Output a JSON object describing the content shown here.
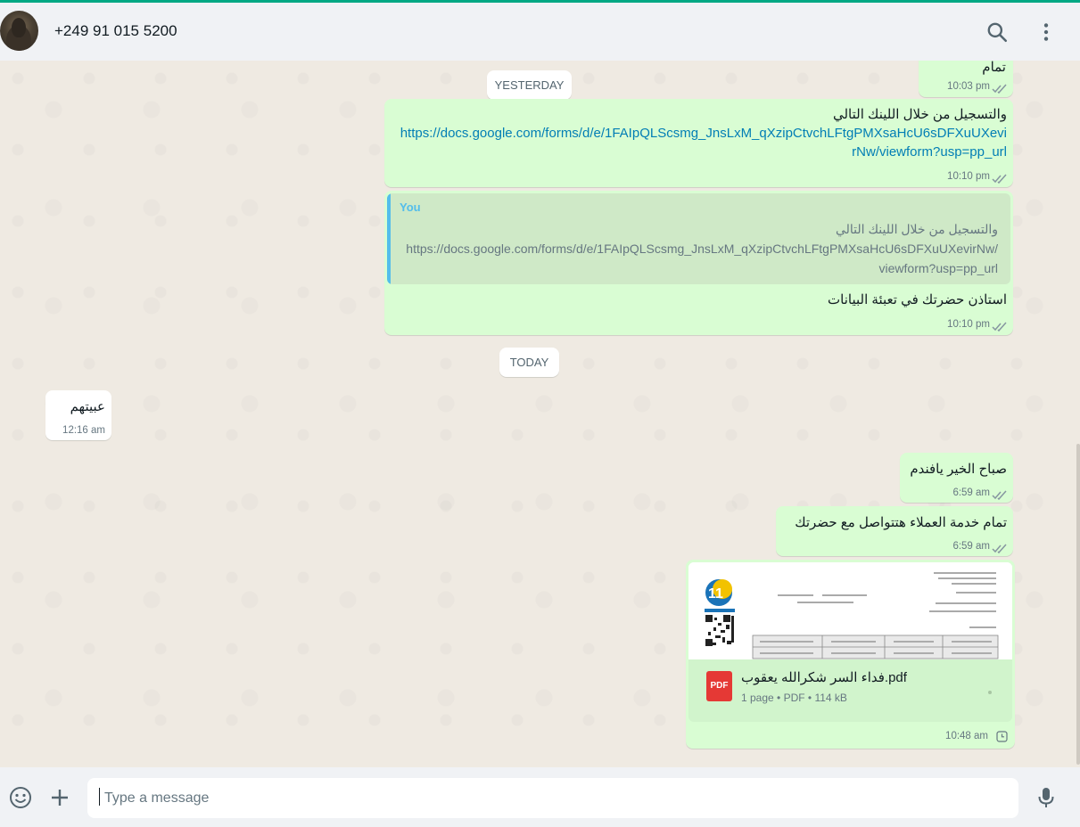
{
  "header": {
    "contact_name": "+249 91 015 5200",
    "search_icon": "search-icon",
    "menu_icon": "kebab-menu-icon"
  },
  "dates": {
    "yesterday": "YESTERDAY",
    "today": "TODAY"
  },
  "messages": {
    "m0": {
      "text": "تمام",
      "time": "10:03 pm",
      "status": "read"
    },
    "m1": {
      "text": "والتسجيل من خلال اللينك التالي",
      "link_line1": "https://docs.google.com/forms/d/e/1FAIpQLScsmg_JnsLxM_qXzipCtvchLFtgPMXsaHcU6sDFXuUXevi",
      "link_line2": "rNw/viewform?usp=pp_url",
      "time": "10:10 pm",
      "status": "read"
    },
    "m2": {
      "quote_author": "You",
      "quote_line1": "والتسجيل من خلال اللينك التالي",
      "quote_line2": "https://docs.google.com/forms/d/e/1FAIpQLScsmg_JnsLxM_qXzipCtvchLFtgPMXsaHcU6sDFXuUXevirNw/",
      "quote_line3": "viewform?usp=pp_url",
      "text": "استاذن حضرتك في تعبئة البيانات",
      "time": "10:10 pm",
      "status": "read"
    },
    "m3": {
      "text": "عبيتهم",
      "time": "12:16 am"
    },
    "m4": {
      "text": "صباح الخير يافندم",
      "time": "6:59 am",
      "status": "read"
    },
    "m5": {
      "text": "تمام خدمة العملاء هتتواصل مع حضرتك",
      "time": "6:59 am",
      "status": "read"
    },
    "m6": {
      "file_name": "فداء السر شكرالله يعقوب.pdf",
      "file_meta": "1 page • PDF • 114 kB",
      "file_type_label": "PDF",
      "time": "10:48 am",
      "status": "pending"
    }
  },
  "composer": {
    "placeholder": "Type a message",
    "emoji_icon": "emoji-icon",
    "attach_icon": "plus-icon",
    "mic_icon": "microphone-icon"
  },
  "colors": {
    "accent": "#00a884",
    "outgoing_bubble": "#d9fdd3",
    "incoming_bubble": "#ffffff",
    "link": "#027eb5",
    "read_tick": "#8696a0"
  }
}
